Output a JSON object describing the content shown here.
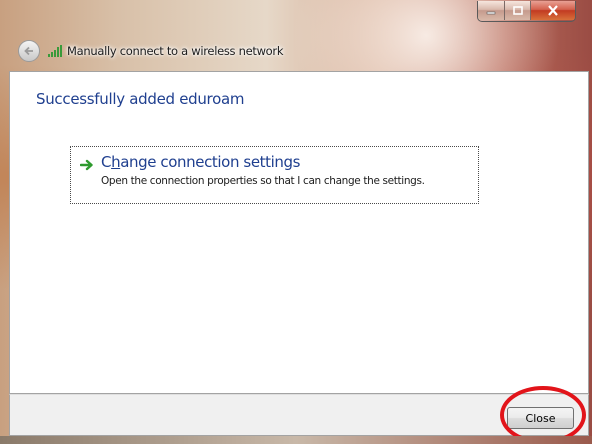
{
  "window": {
    "title": "Manually connect to a wireless network",
    "controls": {
      "minimize": "minimize-icon",
      "maximize": "maximize-icon",
      "close": "close-icon"
    },
    "icons": {
      "back": "back-arrow-icon",
      "network": "wireless-signal-icon"
    }
  },
  "main": {
    "heading": "Successfully added eduroam",
    "option": {
      "title_prefix": "C",
      "title_accel": "h",
      "title_rest": "ange connection settings",
      "description": "Open the connection properties so that I can change the settings.",
      "icon": "green-arrow-icon"
    }
  },
  "footer": {
    "close_label": "Close"
  },
  "colors": {
    "heading": "#1f3f8f",
    "highlight": "#e2141a",
    "arrow": "#2e9a2e"
  }
}
